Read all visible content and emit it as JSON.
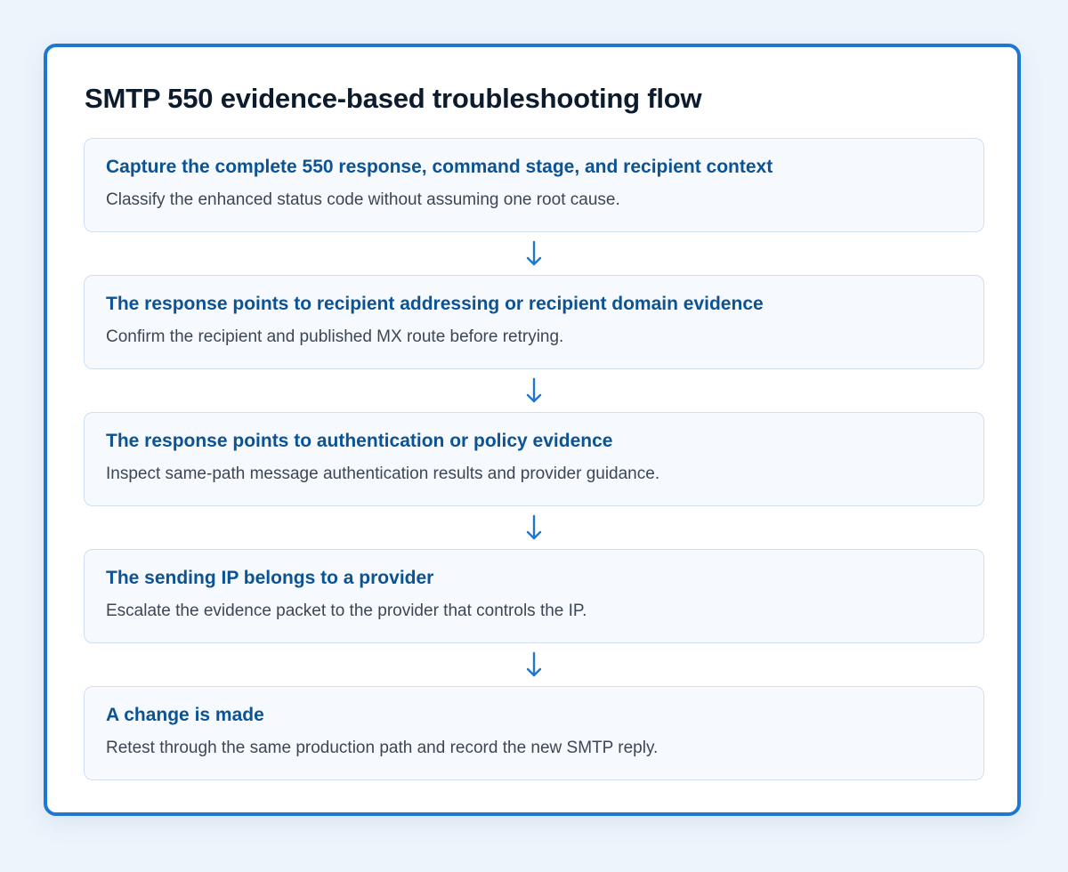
{
  "title": "SMTP 550 evidence-based troubleshooting flow",
  "accent_color": "#1f77d4",
  "steps": [
    {
      "title": "Capture the complete 550 response, command stage, and recipient context",
      "description": "Classify the enhanced status code without assuming one root cause."
    },
    {
      "title": "The response points to recipient addressing or recipient domain evidence",
      "description": "Confirm the recipient and published MX route before retrying."
    },
    {
      "title": "The response points to authentication or policy evidence",
      "description": "Inspect same-path message authentication results and provider guidance."
    },
    {
      "title": "The sending IP belongs to a provider",
      "description": "Escalate the evidence packet to the provider that controls the IP."
    },
    {
      "title": "A change is made",
      "description": "Retest through the same production path and record the new SMTP reply."
    }
  ],
  "connector_icon": "arrow-down-icon"
}
